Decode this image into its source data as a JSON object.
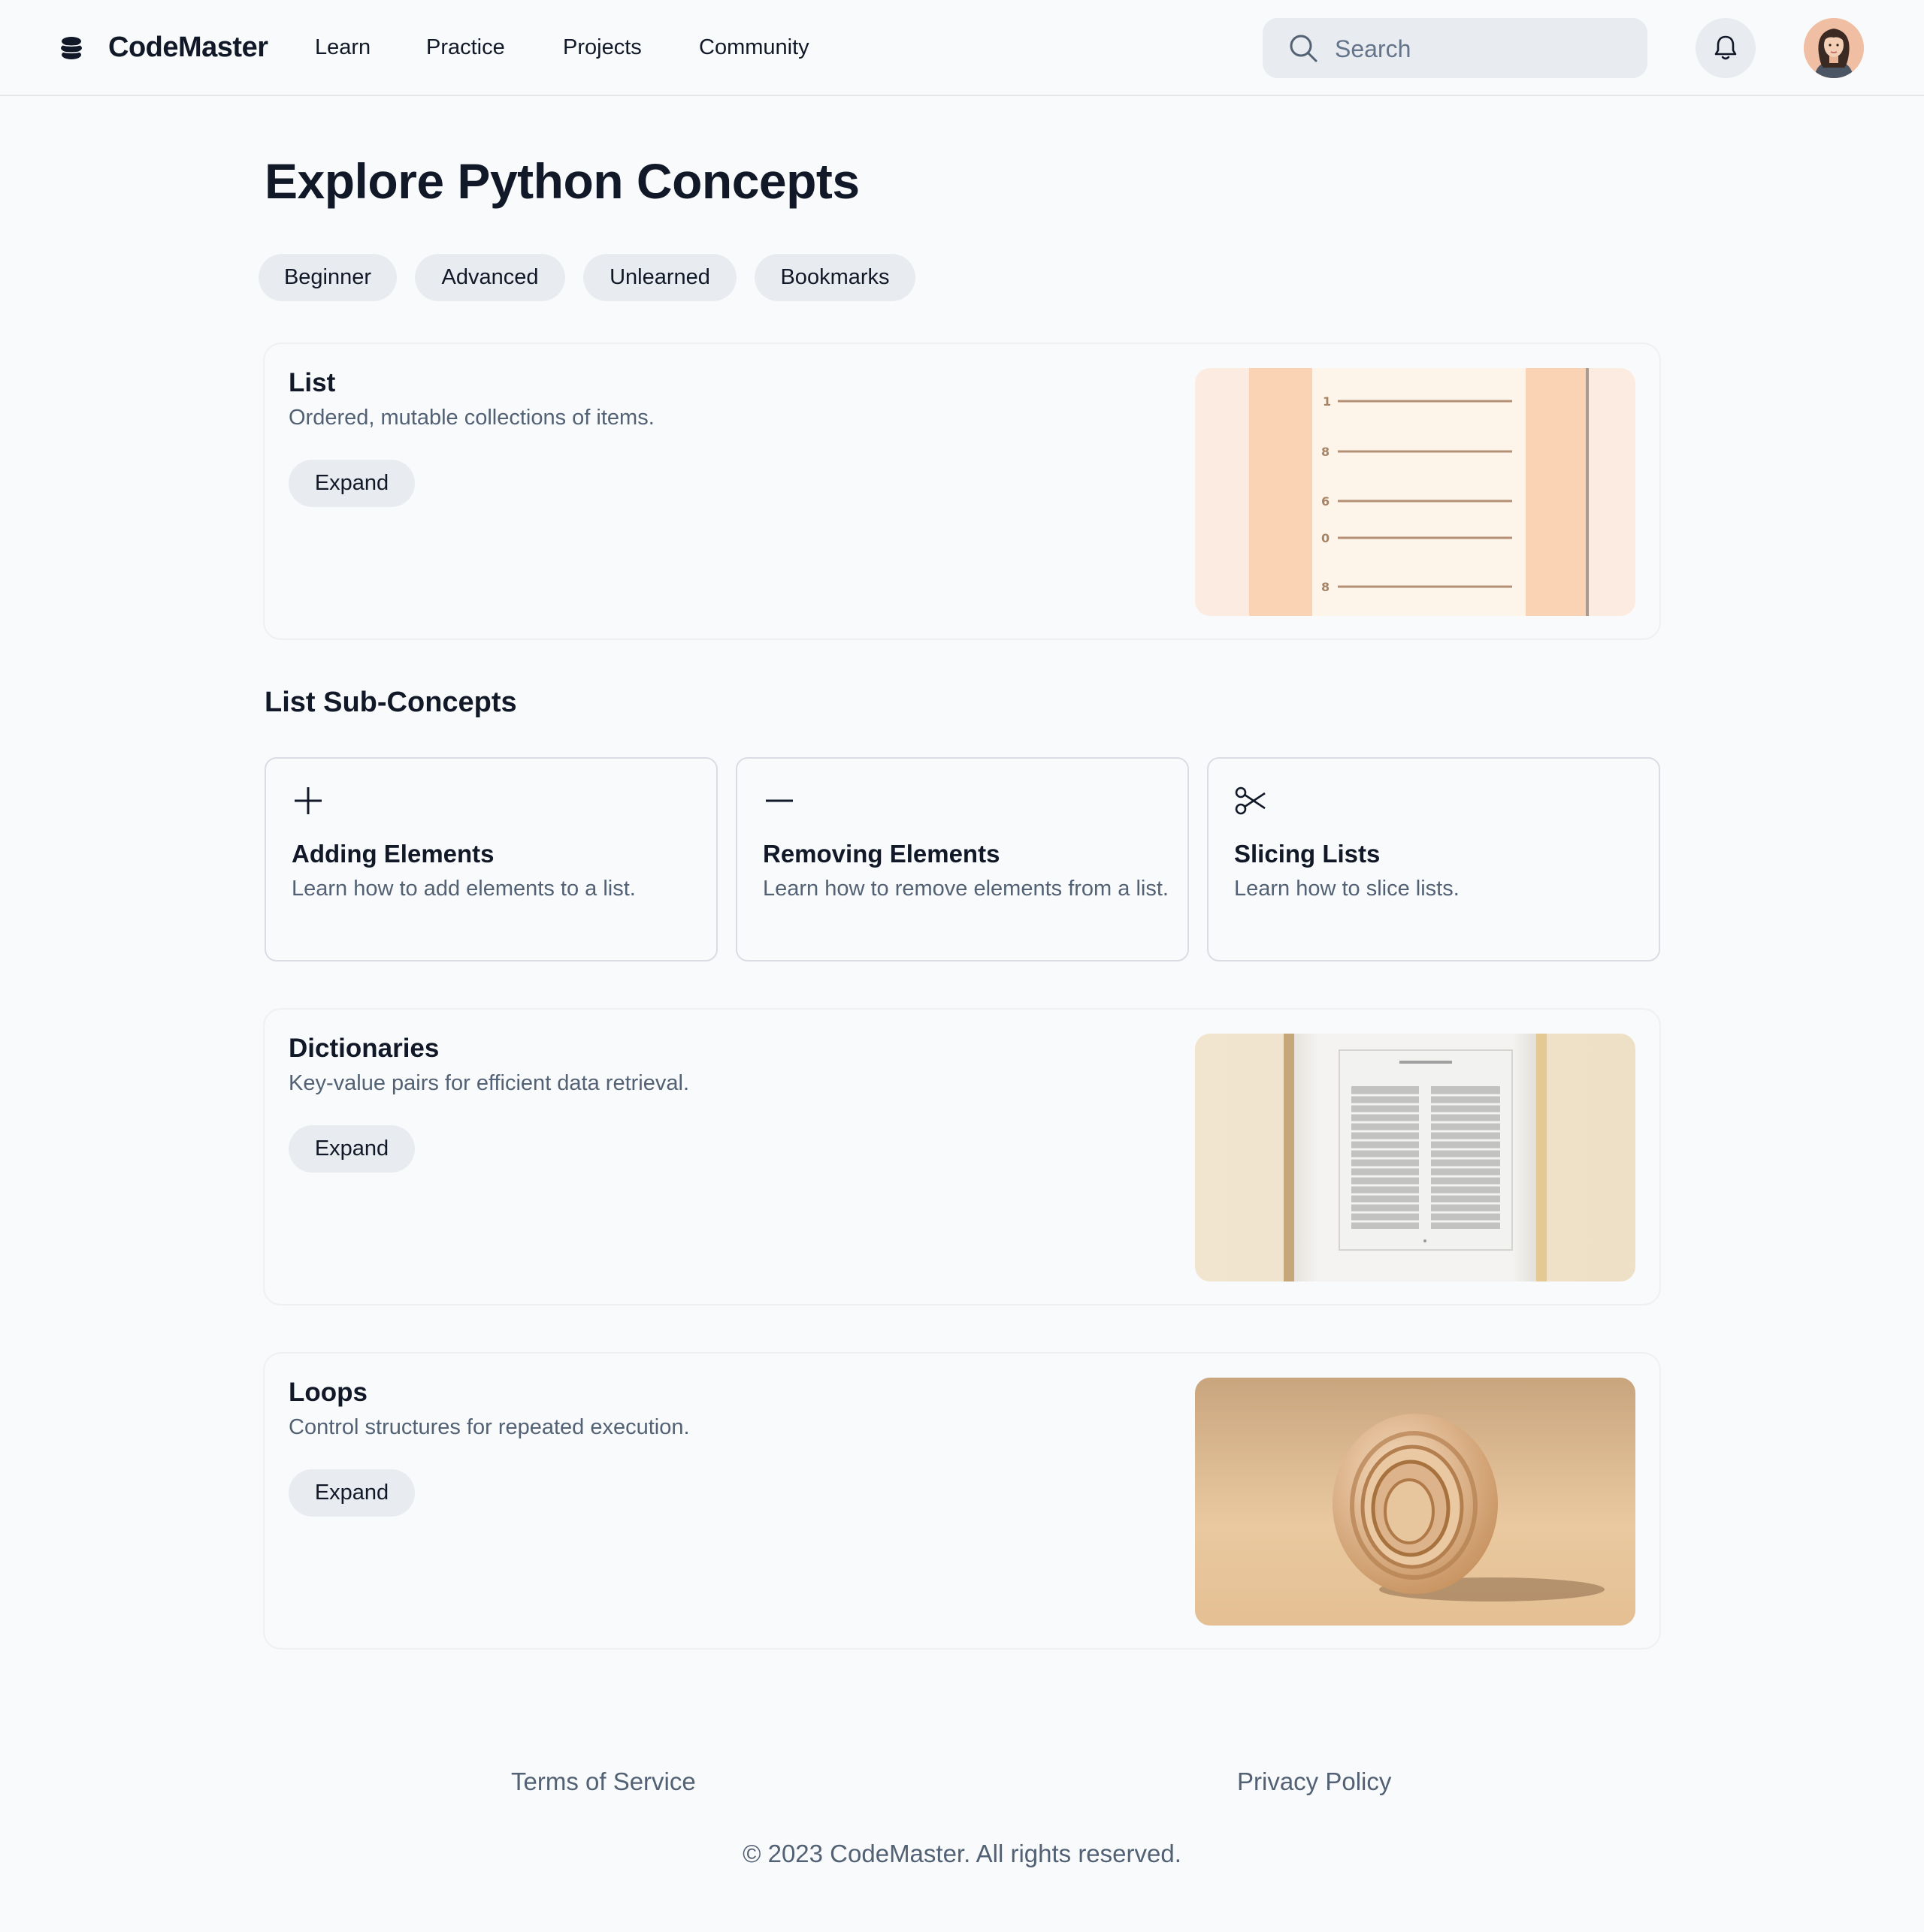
{
  "header": {
    "brand": "CodeMaster",
    "logo_icon": "layers-logo-icon",
    "nav": [
      "Learn",
      "Practice",
      "Projects",
      "Community"
    ],
    "search_placeholder": "Search",
    "search_icon": "search-icon",
    "bell_icon": "bell-icon"
  },
  "main": {
    "title": "Explore Python Concepts",
    "filters": [
      "Beginner",
      "Advanced",
      "Unlearned",
      "Bookmarks"
    ],
    "concepts": [
      {
        "title": "List",
        "description": "Ordered, mutable collections of items.",
        "expand_label": "Expand",
        "image_numbers": [
          "1",
          "8",
          "6",
          "0",
          "8"
        ]
      },
      {
        "title": "Dictionaries",
        "description": "Key-value pairs for efficient data retrieval.",
        "expand_label": "Expand"
      },
      {
        "title": "Loops",
        "description": "Control structures for repeated execution.",
        "expand_label": "Expand"
      }
    ],
    "sub_section_title": "List Sub-Concepts",
    "sub_concepts": [
      {
        "icon": "plus-icon",
        "title": "Adding Elements",
        "description": "Learn how to add elements to a list."
      },
      {
        "icon": "minus-icon",
        "title": "Removing Elements",
        "description": "Learn how to remove elements from a list."
      },
      {
        "icon": "scissors-icon",
        "title": "Slicing Lists",
        "description": "Learn how to slice lists."
      }
    ]
  },
  "footer": {
    "links": [
      "Terms of Service",
      "Privacy Policy"
    ],
    "copyright": "© 2023 CodeMaster. All rights reserved."
  },
  "colors": {
    "background": "#f9fafb",
    "chip_bg": "#e8ebef",
    "muted_text": "#526174",
    "border": "#d9dde3"
  }
}
